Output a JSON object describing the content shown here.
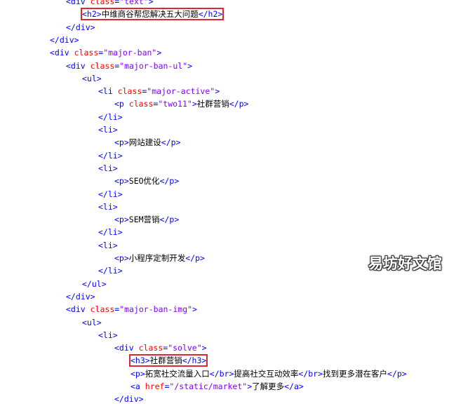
{
  "lines": [
    {
      "indent": 4,
      "parts": [
        [
          "tag",
          "<div "
        ],
        [
          "attr",
          "class"
        ],
        [
          "tag",
          "="
        ],
        [
          "val",
          "\"text\""
        ],
        [
          "tag",
          ">"
        ]
      ]
    },
    {
      "indent": 5,
      "highlight": true,
      "parts": [
        [
          "tag",
          "<h2>"
        ],
        [
          "str",
          "中维商谷帮您解决五大问题"
        ],
        [
          "tag",
          "</h2>"
        ]
      ]
    },
    {
      "indent": 4,
      "parts": [
        [
          "tag",
          "</div>"
        ]
      ]
    },
    {
      "indent": 3,
      "parts": [
        [
          "tag",
          "</div>"
        ]
      ]
    },
    {
      "indent": 3,
      "parts": [
        [
          "tag",
          "<div "
        ],
        [
          "attr",
          "class"
        ],
        [
          "tag",
          "="
        ],
        [
          "val",
          "\"major-ban\""
        ],
        [
          "tag",
          ">"
        ]
      ]
    },
    {
      "indent": 4,
      "parts": [
        [
          "tag",
          "<div "
        ],
        [
          "attr",
          "class"
        ],
        [
          "tag",
          "="
        ],
        [
          "val",
          "\"major-ban-ul\""
        ],
        [
          "tag",
          ">"
        ]
      ]
    },
    {
      "indent": 5,
      "parts": [
        [
          "tag",
          "<ul>"
        ]
      ]
    },
    {
      "indent": 6,
      "parts": [
        [
          "tag",
          "<li "
        ],
        [
          "attr",
          "class"
        ],
        [
          "tag",
          "="
        ],
        [
          "val",
          "\"major-active\""
        ],
        [
          "tag",
          ">"
        ]
      ]
    },
    {
      "indent": 7,
      "parts": [
        [
          "tag",
          "<p "
        ],
        [
          "attr",
          "class"
        ],
        [
          "tag",
          "="
        ],
        [
          "val",
          "\"two11\""
        ],
        [
          "tag",
          ">"
        ],
        [
          "str",
          "社群营销"
        ],
        [
          "tag",
          "</p>"
        ]
      ]
    },
    {
      "indent": 6,
      "parts": [
        [
          "tag",
          "</li>"
        ]
      ]
    },
    {
      "indent": 6,
      "parts": [
        [
          "tag",
          "<li>"
        ]
      ]
    },
    {
      "indent": 7,
      "parts": [
        [
          "tag",
          "<p>"
        ],
        [
          "str",
          "网站建设"
        ],
        [
          "tag",
          "</p>"
        ]
      ]
    },
    {
      "indent": 6,
      "parts": [
        [
          "tag",
          "</li>"
        ]
      ]
    },
    {
      "indent": 6,
      "parts": [
        [
          "tag",
          "<li>"
        ]
      ]
    },
    {
      "indent": 7,
      "parts": [
        [
          "tag",
          "<p>"
        ],
        [
          "str",
          "SEO优化"
        ],
        [
          "tag",
          "</p>"
        ]
      ]
    },
    {
      "indent": 6,
      "parts": [
        [
          "tag",
          "</li>"
        ]
      ]
    },
    {
      "indent": 6,
      "parts": [
        [
          "tag",
          "<li>"
        ]
      ]
    },
    {
      "indent": 7,
      "parts": [
        [
          "tag",
          "<p>"
        ],
        [
          "str",
          "SEM营销"
        ],
        [
          "tag",
          "</p>"
        ]
      ]
    },
    {
      "indent": 6,
      "parts": [
        [
          "tag",
          "</li>"
        ]
      ]
    },
    {
      "indent": 6,
      "parts": [
        [
          "tag",
          "<li>"
        ]
      ]
    },
    {
      "indent": 7,
      "parts": [
        [
          "tag",
          "<p>"
        ],
        [
          "str",
          "小程序定制开发"
        ],
        [
          "tag",
          "</p>"
        ]
      ]
    },
    {
      "indent": 6,
      "parts": [
        [
          "tag",
          "</li>"
        ]
      ]
    },
    {
      "indent": 5,
      "parts": [
        [
          "tag",
          "</ul>"
        ]
      ]
    },
    {
      "indent": 4,
      "parts": [
        [
          "tag",
          "</div>"
        ]
      ]
    },
    {
      "indent": 4,
      "parts": [
        [
          "tag",
          "<div "
        ],
        [
          "attr",
          "class"
        ],
        [
          "tag",
          "="
        ],
        [
          "val",
          "\"major-ban-img\""
        ],
        [
          "tag",
          ">"
        ]
      ]
    },
    {
      "indent": 5,
      "parts": [
        [
          "tag",
          "<ul>"
        ]
      ]
    },
    {
      "indent": 6,
      "parts": [
        [
          "tag",
          "<li>"
        ]
      ]
    },
    {
      "indent": 7,
      "parts": [
        [
          "tag",
          "<div "
        ],
        [
          "attr",
          "class"
        ],
        [
          "tag",
          "="
        ],
        [
          "val",
          "\"solve\""
        ],
        [
          "tag",
          ">"
        ]
      ]
    },
    {
      "indent": 8,
      "highlight": true,
      "parts": [
        [
          "tag",
          "<h3>"
        ],
        [
          "str",
          "社群营销"
        ],
        [
          "tag",
          "</h3>"
        ]
      ]
    },
    {
      "indent": 8,
      "parts": [
        [
          "tag",
          "<p>"
        ],
        [
          "str",
          "拓宽社交流量入口"
        ],
        [
          "tag",
          "</br>"
        ],
        [
          "str",
          "提高社交互动效率"
        ],
        [
          "tag",
          "</br>"
        ],
        [
          "str",
          "找到更多潜在客户"
        ],
        [
          "tag",
          "</p>"
        ]
      ]
    },
    {
      "indent": 8,
      "parts": [
        [
          "tag",
          "<a "
        ],
        [
          "attr",
          "href"
        ],
        [
          "tag",
          "="
        ],
        [
          "val",
          "\"/static/market\""
        ],
        [
          "tag",
          ">"
        ],
        [
          "str",
          "了解更多"
        ],
        [
          "tag",
          "</a>"
        ]
      ]
    },
    {
      "indent": 7,
      "parts": [
        [
          "tag",
          "</div>"
        ]
      ]
    }
  ],
  "watermark": "易坊好文馆"
}
